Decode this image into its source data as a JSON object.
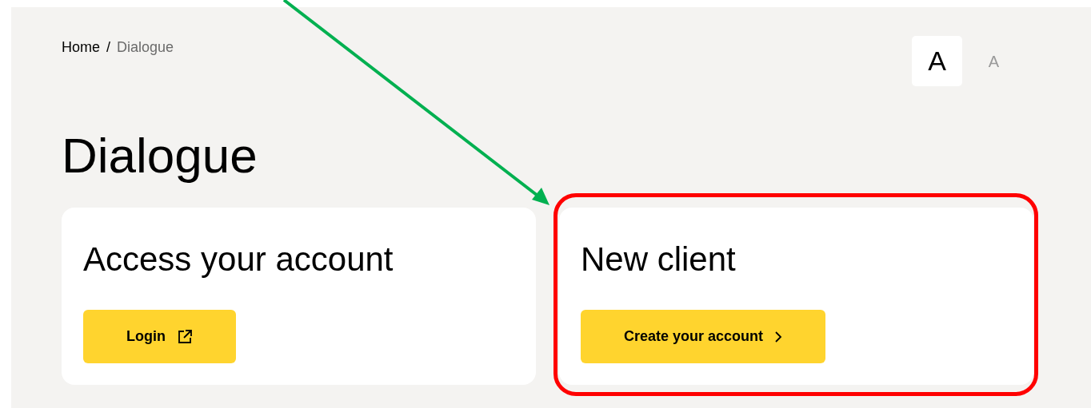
{
  "breadcrumb": {
    "separator": "/",
    "items": [
      {
        "label": "Home",
        "current": false
      },
      {
        "label": "Dialogue",
        "current": true
      }
    ]
  },
  "font_size_options": [
    {
      "label": "A",
      "kind": "large",
      "selected": true
    },
    {
      "label": "A",
      "kind": "small",
      "selected": false
    }
  ],
  "title": "Dialogue",
  "cards": [
    {
      "heading": "Access your account",
      "button": {
        "label": "Login",
        "kind": "external"
      },
      "highlighted": false
    },
    {
      "heading": "New client",
      "button": {
        "label": "Create your account",
        "kind": "next"
      },
      "highlighted": true
    }
  ],
  "annotations": [
    {
      "kind": "arrow",
      "color": "#00b050"
    }
  ]
}
